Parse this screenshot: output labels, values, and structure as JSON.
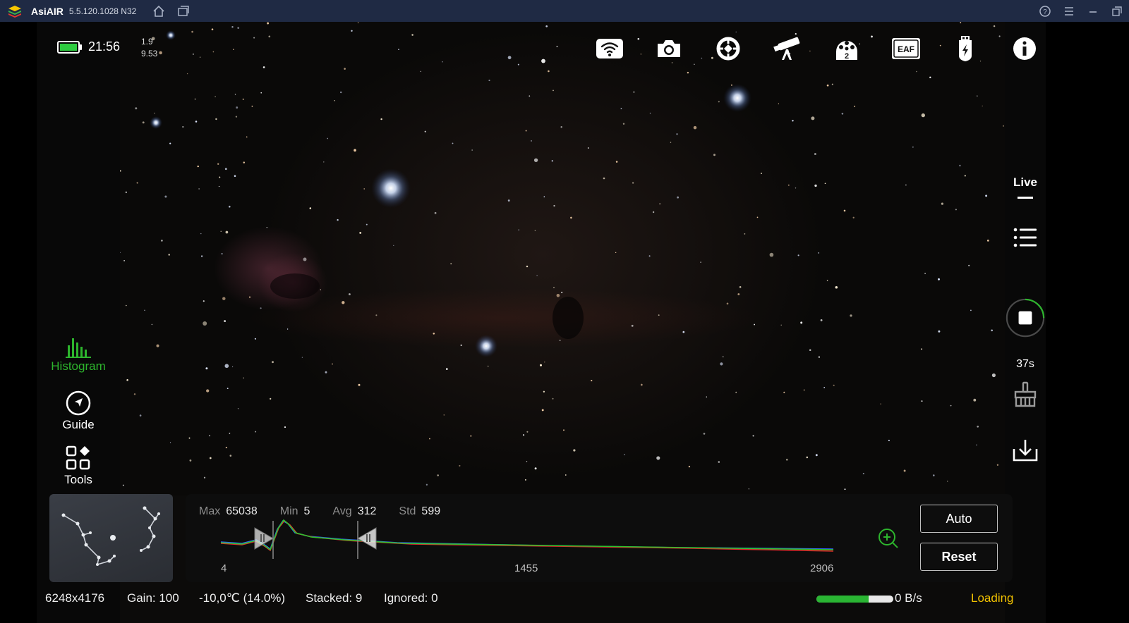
{
  "window": {
    "app_name": "AsiAIR",
    "version": "5.5.120.1028 N32",
    "controls": [
      "help-icon",
      "menu-icon",
      "minimize-icon",
      "restore-icon"
    ]
  },
  "status": {
    "time": "21:56",
    "value_top": "1.9",
    "value_bottom": "9.53",
    "battery_level": 1.0
  },
  "top_icons": [
    "wifi-icon",
    "camera-icon",
    "crosshair-icon",
    "telescope-icon",
    "filter-wheel-icon",
    "eaf-icon",
    "usb-power-icon",
    "info-icon"
  ],
  "top_icon_texts": {
    "filter_wheel": "2",
    "eaf": "EAF"
  },
  "left_nav": {
    "histogram": "Histogram",
    "guide": "Guide",
    "tools": "Tools",
    "active": "Histogram",
    "active_color": "#2db52d"
  },
  "right_panel": {
    "live": "Live",
    "exposure_time": "37s",
    "progress": 0.25,
    "accent_color": "#2db52d"
  },
  "histogram": {
    "max_label": "Max",
    "max": "65038",
    "min_label": "Min",
    "min": "5",
    "avg_label": "Avg",
    "avg": "312",
    "std_label": "Std",
    "std": "599",
    "axis_labels": [
      "4",
      "1455",
      "2906"
    ],
    "buttons": {
      "auto": "Auto",
      "reset": "Reset"
    }
  },
  "bottom": {
    "resolution": "6248x4176",
    "gain": "Gain: 100",
    "temperature": "-10,0℃ (14.0%)",
    "stacked": "Stacked: 9",
    "ignored": "Ignored: 0",
    "download_progress": 0.68,
    "speed": "0 B/s",
    "loading": "Loading"
  }
}
